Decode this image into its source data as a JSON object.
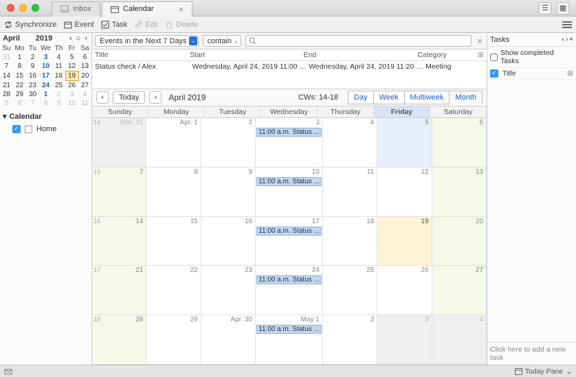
{
  "tabs": {
    "inbox": "Inbox",
    "calendar": "Calendar"
  },
  "toolbar": {
    "synchronize": "Synchronize",
    "event": "Event",
    "task": "Task",
    "edit": "Edit",
    "delete": "Delete"
  },
  "minical": {
    "month": "April",
    "year": "2019",
    "wdays": [
      "Su",
      "Mo",
      "Tu",
      "We",
      "Th",
      "Fr",
      "Sa"
    ],
    "rows": [
      [
        {
          "n": "31",
          "o": true
        },
        {
          "n": "1"
        },
        {
          "n": "2"
        },
        {
          "n": "3",
          "b": true
        },
        {
          "n": "4"
        },
        {
          "n": "5"
        },
        {
          "n": "6"
        }
      ],
      [
        {
          "n": "7"
        },
        {
          "n": "8"
        },
        {
          "n": "9"
        },
        {
          "n": "10",
          "b": true
        },
        {
          "n": "11"
        },
        {
          "n": "12"
        },
        {
          "n": "13"
        }
      ],
      [
        {
          "n": "14"
        },
        {
          "n": "15"
        },
        {
          "n": "16"
        },
        {
          "n": "17",
          "b": true
        },
        {
          "n": "18"
        },
        {
          "n": "19",
          "t": true
        },
        {
          "n": "20"
        }
      ],
      [
        {
          "n": "21"
        },
        {
          "n": "22"
        },
        {
          "n": "23"
        },
        {
          "n": "24",
          "b": true
        },
        {
          "n": "25"
        },
        {
          "n": "26"
        },
        {
          "n": "27"
        }
      ],
      [
        {
          "n": "28"
        },
        {
          "n": "29"
        },
        {
          "n": "30"
        },
        {
          "n": "1",
          "o": true,
          "b": true
        },
        {
          "n": "2",
          "o": true
        },
        {
          "n": "3",
          "o": true
        },
        {
          "n": "4",
          "o": true
        }
      ],
      [
        {
          "n": "5",
          "o": true
        },
        {
          "n": "6",
          "o": true
        },
        {
          "n": "7",
          "o": true
        },
        {
          "n": "8",
          "o": true
        },
        {
          "n": "9",
          "o": true
        },
        {
          "n": "10",
          "o": true
        },
        {
          "n": "11",
          "o": true
        }
      ]
    ]
  },
  "sidebar": {
    "heading": "Calendar",
    "items": [
      {
        "label": "Home"
      }
    ]
  },
  "filter": {
    "range": "Events in the Next 7 Days",
    "match": "contain",
    "search_placeholder": ""
  },
  "evlist": {
    "headers": {
      "title": "Title",
      "start": "Start",
      "end": "End",
      "category": "Category"
    },
    "rows": [
      {
        "title": "Status check / Alex",
        "start": "Wednesday, April 24, 2019 11:00 a.m.",
        "end": "Wednesday, April 24, 2019 11:20 a.m.",
        "category": "Meeting"
      }
    ]
  },
  "calctrl": {
    "today": "Today",
    "month_label": "April 2019",
    "cw_label": "CWs: 14-18",
    "views": {
      "day": "Day",
      "week": "Week",
      "multiweek": "Multiweek",
      "month": "Month"
    }
  },
  "calhead": [
    "Sunday",
    "Monday",
    "Tuesday",
    "Wednesday",
    "Thursday",
    "Friday",
    "Saturday"
  ],
  "weeks": [
    {
      "wk": "14",
      "days": [
        {
          "n": "Mar. 31",
          "o": true
        },
        {
          "n": "Apr. 1"
        },
        {
          "n": "2"
        },
        {
          "n": "3",
          "ev": "11:00 a.m. Status ..."
        },
        {
          "n": "4"
        },
        {
          "n": "5",
          "fri": true
        },
        {
          "n": "6",
          "wknd": true
        }
      ]
    },
    {
      "wk": "15",
      "days": [
        {
          "n": "7",
          "wknd": true
        },
        {
          "n": "8"
        },
        {
          "n": "9"
        },
        {
          "n": "10",
          "ev": "11:00 a.m. Status ..."
        },
        {
          "n": "11"
        },
        {
          "n": "12"
        },
        {
          "n": "13",
          "wknd": true
        }
      ]
    },
    {
      "wk": "16",
      "days": [
        {
          "n": "14",
          "wknd": true
        },
        {
          "n": "15"
        },
        {
          "n": "16"
        },
        {
          "n": "17",
          "ev": "11:00 a.m. Status ..."
        },
        {
          "n": "18"
        },
        {
          "n": "19",
          "today": true
        },
        {
          "n": "20",
          "wknd": true
        }
      ]
    },
    {
      "wk": "17",
      "days": [
        {
          "n": "21",
          "wknd": true
        },
        {
          "n": "22"
        },
        {
          "n": "23"
        },
        {
          "n": "24",
          "ev": "11:00 a.m. Status ..."
        },
        {
          "n": "25"
        },
        {
          "n": "26"
        },
        {
          "n": "27",
          "wknd": true
        }
      ]
    },
    {
      "wk": "18",
      "days": [
        {
          "n": "28",
          "wknd": true
        },
        {
          "n": "29"
        },
        {
          "n": "Apr. 30"
        },
        {
          "n": "May 1",
          "ev": "11:00 a.m. Status ..."
        },
        {
          "n": "2"
        },
        {
          "n": "3",
          "o": true
        },
        {
          "n": "4",
          "o": true
        }
      ]
    }
  ],
  "tasks": {
    "title": "Tasks",
    "show_completed": "Show completed Tasks",
    "col_title": "Title",
    "new_task": "Click here to add a new task"
  },
  "status": {
    "today_pane": "Today Pane"
  }
}
